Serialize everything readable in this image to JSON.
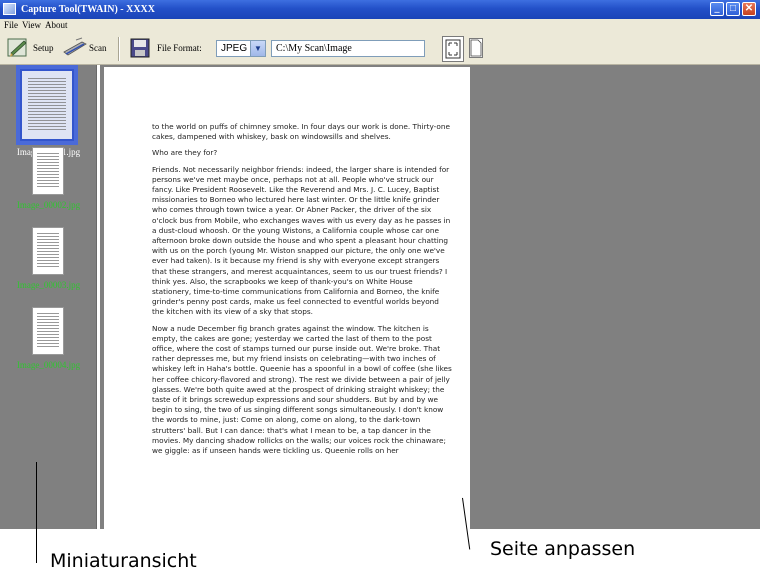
{
  "window": {
    "title": "Capture Tool(TWAIN) -  XXXX",
    "buttons": {
      "minimize": "_",
      "maximize": "□",
      "close": "✕"
    }
  },
  "menu": {
    "items": [
      "File",
      "View",
      "About"
    ]
  },
  "toolbar": {
    "setup_label": "Setup",
    "scan_label": "Scan",
    "file_format_label": "File Format:",
    "file_format_value": "JPEG",
    "path_value": "C:\\My Scan\\Image",
    "dropdown_arrow": "▼"
  },
  "thumbnails": [
    {
      "caption": "Image_00001.jpg",
      "selected": true
    },
    {
      "caption": "Image_00002.jpg",
      "selected": false
    },
    {
      "caption": "Image_00003.jpg",
      "selected": false
    },
    {
      "caption": "Image_00004.jpg",
      "selected": false
    }
  ],
  "document": {
    "paragraphs": [
      "to the world on puffs of chimney smoke. In four days our work is done. Thirty-one cakes, dampened with whiskey, bask on windowsills and shelves.",
      "Who are they for?",
      "Friends. Not necessarily neighbor friends: indeed, the larger share is intended for persons we've met maybe once, perhaps not at all. People who've struck our fancy. Like President Roosevelt. Like the Reverend and Mrs. J. C. Lucey, Baptist missionaries to Borneo who lectured here last winter. Or the little knife grinder who comes through town twice a year. Or Abner Packer, the driver of the six o'clock bus from Mobile, who exchanges waves with us every day as he passes in a dust-cloud whoosh. Or the young Wistons, a California couple whose car one afternoon broke down outside the house and who spent a pleasant hour chatting with us on the porch (young Mr. Wiston snapped our picture, the only one we've ever had taken). Is it because my friend is shy with everyone except strangers that these strangers, and merest acquaintances, seem to us our truest friends? I think yes. Also, the scrapbooks we keep of thank-you's on White House stationery, time-to-time communications from California and Borneo, the knife grinder's penny post cards, make us feel connected to eventful worlds beyond the kitchen with its view of a sky that stops.",
      "Now a nude December fig branch grates against the window. The kitchen is empty, the cakes are gone; yesterday we carted the last of them to the post office, where the cost of stamps turned our purse inside out. We're broke. That rather depresses me, but my friend insists on celebrating—with two inches of whiskey left in Haha's bottle. Queenie has a spoonful in a bowl of coffee (she likes her coffee chicory-flavored and strong). The rest we divide between a pair of jelly glasses. We're both quite awed at the prospect of drinking straight whiskey; the taste of it brings screwedup expressions and sour shudders. But by and by we begin to sing, the two of us singing different songs simultaneously. I don't know the words to mine, just: Come on along, come on along, to the dark-town strutters' ball. But I can dance: that's what I mean to be, a tap dancer in the movies. My dancing shadow rollicks on the walls; our voices rock the chinaware; we giggle: as if unseen hands were tickling us. Queenie rolls on her"
    ]
  },
  "annotations": {
    "thumbnail_view": "Miniaturansicht",
    "fit_page": "Seite anpassen"
  }
}
